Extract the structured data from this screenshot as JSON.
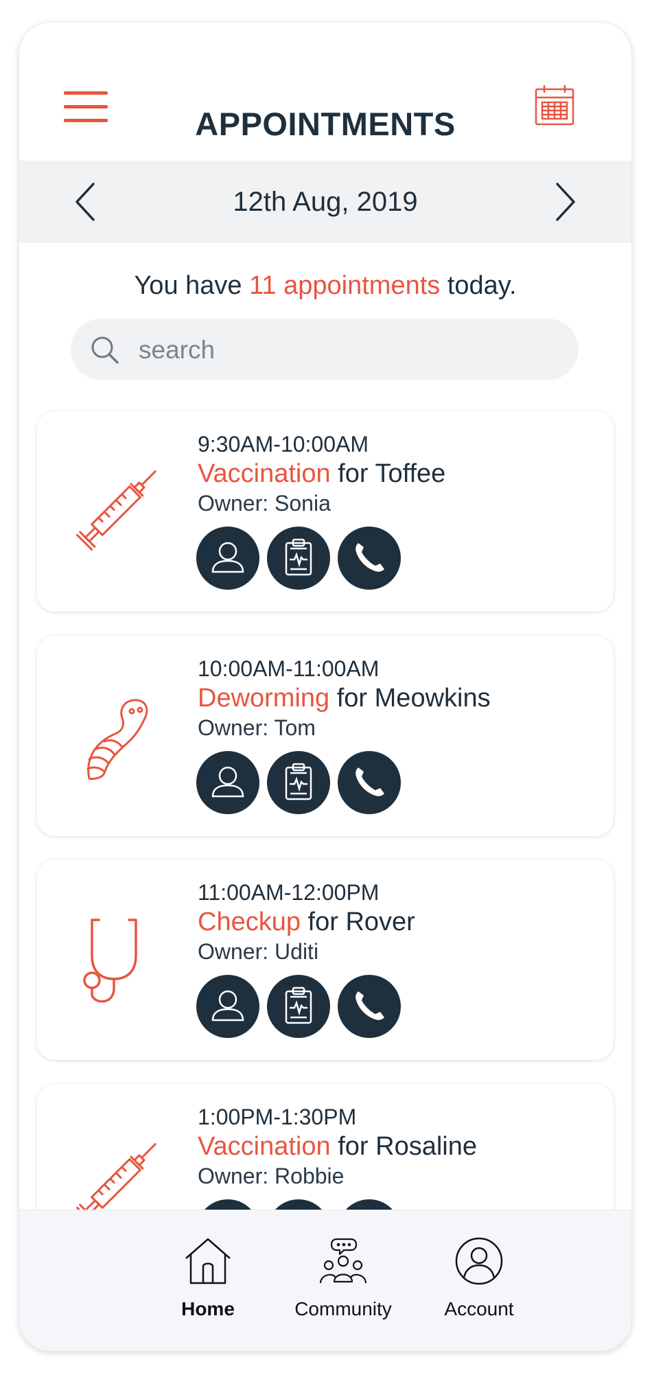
{
  "header": {
    "title": "APPOINTMENTS"
  },
  "date_nav": {
    "date": "12th Aug, 2019"
  },
  "summary": {
    "prefix": "You have",
    "highlight": "11 appointments",
    "suffix": "today."
  },
  "search": {
    "placeholder": "search",
    "value": ""
  },
  "appointments": [
    {
      "time": "9:30AM-10:00AM",
      "service": "Vaccination",
      "connector": "for",
      "pet": "Toffee",
      "owner": "Owner: Sonia",
      "icon": "syringe-icon"
    },
    {
      "time": "10:00AM-11:00AM",
      "service": "Deworming",
      "connector": "for",
      "pet": "Meowkins",
      "owner": "Owner: Tom",
      "icon": "worm-icon"
    },
    {
      "time": "11:00AM-12:00PM",
      "service": "Checkup",
      "connector": "for",
      "pet": "Rover",
      "owner": "Owner: Uditi",
      "icon": "stethoscope-icon"
    },
    {
      "time": "1:00PM-1:30PM",
      "service": "Vaccination",
      "connector": "for",
      "pet": "Rosaline",
      "owner": "Owner: Robbie",
      "icon": "syringe-icon"
    }
  ],
  "tabs": [
    {
      "label": "Home",
      "icon": "home-icon",
      "active": true
    },
    {
      "label": "Community",
      "icon": "community-icon",
      "active": false
    },
    {
      "label": "Account",
      "icon": "account-icon",
      "active": false
    }
  ],
  "colors": {
    "accent": "#e8553f",
    "dark": "#1e2f3d",
    "bar": "#f1f2f3"
  }
}
